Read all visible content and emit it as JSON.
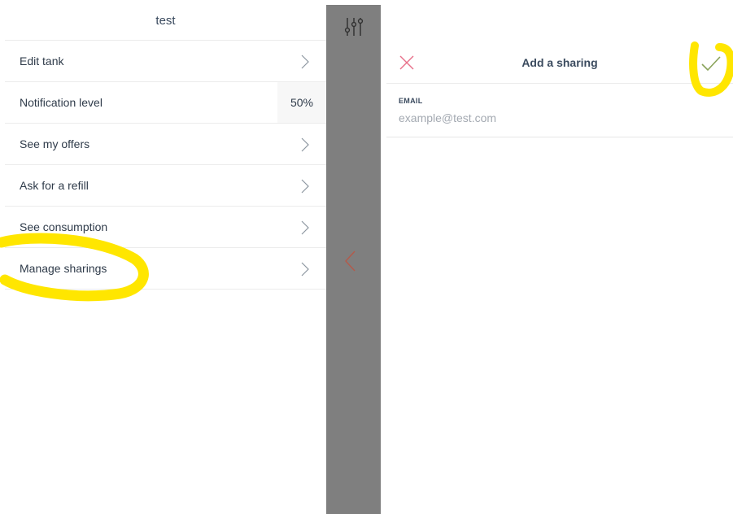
{
  "left": {
    "title": "test",
    "items": [
      {
        "label": "Edit tank"
      },
      {
        "label": "Notification level",
        "value": "50%"
      },
      {
        "label": "See my offers"
      },
      {
        "label": "Ask for a refill"
      },
      {
        "label": "See consumption"
      },
      {
        "label": "Manage sharings"
      }
    ]
  },
  "right": {
    "title": "Add a sharing",
    "email_label": "EMAIL",
    "email_placeholder": "example@test.com",
    "email_value": ""
  },
  "colors": {
    "close_icon": "#e8708a",
    "check_icon": "#8aa35a",
    "back_chevron": "#b45a4a",
    "strip": "#7f7f7f",
    "highlight": "#ffe600"
  },
  "icons": [
    "chevron-right-icon",
    "filter-sliders-icon",
    "chevron-left-icon",
    "close-icon",
    "checkmark-icon"
  ]
}
